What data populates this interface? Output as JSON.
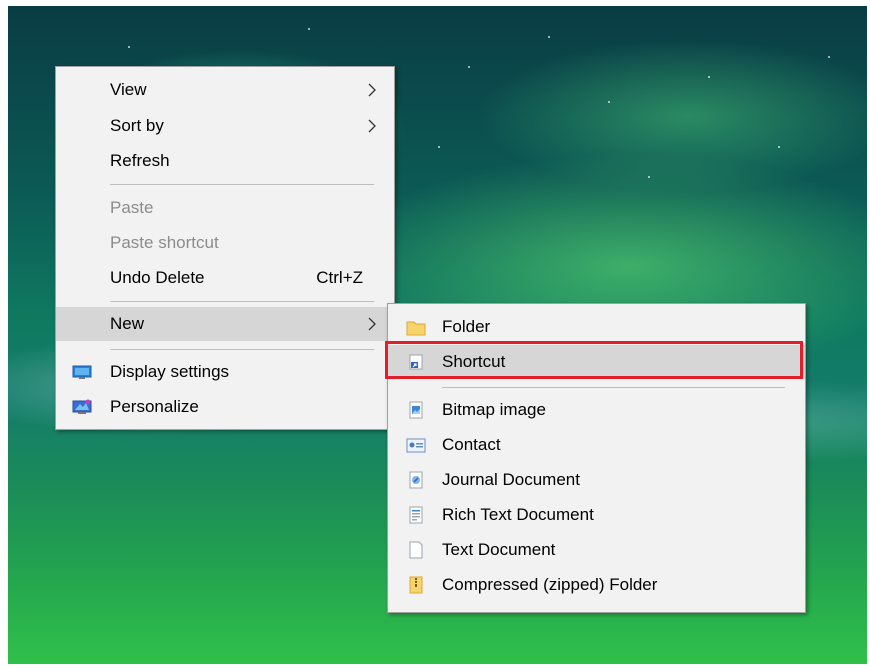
{
  "context_menu": {
    "items": [
      {
        "label": "View",
        "submenu": true
      },
      {
        "label": "Sort by",
        "submenu": true
      },
      {
        "label": "Refresh"
      },
      {
        "label": "Paste",
        "disabled": true
      },
      {
        "label": "Paste shortcut",
        "disabled": true
      },
      {
        "label": "Undo Delete",
        "accelerator": "Ctrl+Z"
      },
      {
        "label": "New",
        "submenu": true,
        "highlighted": true
      },
      {
        "label": "Display settings",
        "icon": "display-icon"
      },
      {
        "label": "Personalize",
        "icon": "personalize-icon"
      }
    ]
  },
  "new_submenu": {
    "items": [
      {
        "label": "Folder",
        "icon": "folder-icon"
      },
      {
        "label": "Shortcut",
        "icon": "shortcut-icon",
        "highlighted": true,
        "outlined_red": true
      },
      {
        "label": "Bitmap image",
        "icon": "bitmap-icon"
      },
      {
        "label": "Contact",
        "icon": "contact-icon"
      },
      {
        "label": "Journal Document",
        "icon": "journal-icon"
      },
      {
        "label": "Rich Text Document",
        "icon": "rich-text-icon"
      },
      {
        "label": "Text Document",
        "icon": "text-document-icon"
      },
      {
        "label": "Compressed (zipped) Folder",
        "icon": "zip-folder-icon"
      }
    ]
  },
  "colors": {
    "menu_bg": "#f2f2f2",
    "highlight": "#d6d6d6",
    "disabled_text": "#8c8c8c",
    "annotation_red": "#e21e2b"
  }
}
